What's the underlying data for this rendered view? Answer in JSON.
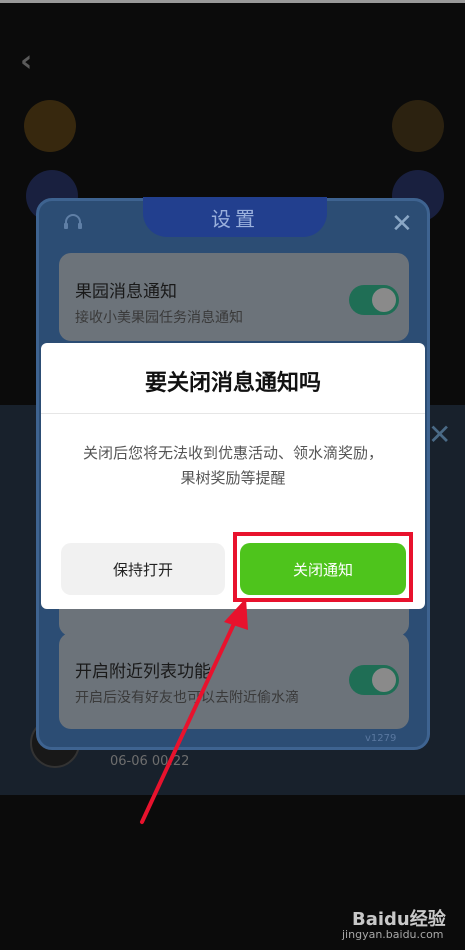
{
  "settings": {
    "title": "设置",
    "items": [
      {
        "title": "果园消息通知",
        "desc": "接收小美果园任务消息通知",
        "enabled": true
      },
      {
        "title": "开启附近列表功能",
        "desc": "开启后没有好友也可以去附近偷水滴",
        "enabled": true
      }
    ],
    "version": "v1279"
  },
  "background": {
    "date": "06-06 00:22"
  },
  "modal": {
    "title": "要关闭消息通知吗",
    "message": "关闭后您将无法收到优惠活动、领水滴奖励，果树奖励等提醒",
    "keep_button": "保持打开",
    "close_button": "关闭通知"
  },
  "annotation": {
    "highlight_color": "#e8122d"
  },
  "watermark": {
    "brand": "Baidu经验",
    "url": "jingyan.baidu.com"
  },
  "colors": {
    "accent_green": "#4ec41c",
    "toggle_green": "#1f6e55"
  }
}
